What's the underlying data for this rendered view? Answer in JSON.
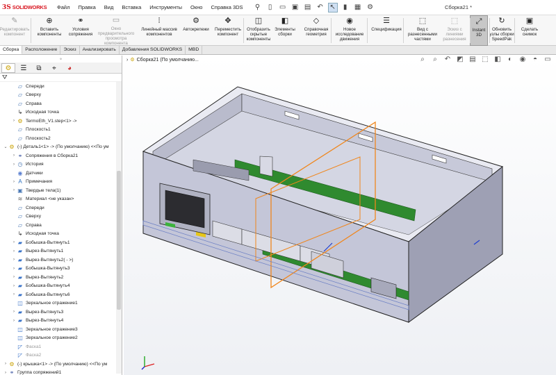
{
  "app": {
    "logo_ds": "3S",
    "logo_name": "SOLIDWORKS",
    "document_title": "Сборка21 *"
  },
  "menu": [
    "Файл",
    "Правка",
    "Вид",
    "Вставка",
    "Инструменты",
    "Окно",
    "Справка 3DS"
  ],
  "ribbon": [
    {
      "label": "Редактировать компонент",
      "icon": "edit-component-icon",
      "glyph": "✎",
      "disabled": true
    },
    {
      "label": "Вставить компоненты",
      "icon": "insert-components-icon",
      "glyph": "⊕",
      "disabled": false
    },
    {
      "label": "Условия сопряжения",
      "icon": "mate-icon",
      "glyph": "⚭",
      "disabled": false
    },
    {
      "label": "Окно предварительного просмотра компонента",
      "icon": "component-preview-icon",
      "glyph": "▭",
      "disabled": true
    },
    {
      "label": "Линейный массив компонентов",
      "icon": "linear-pattern-icon",
      "glyph": "⁞",
      "disabled": false
    },
    {
      "label": "Автокрепежи",
      "icon": "smart-fasteners-icon",
      "glyph": "⚙",
      "disabled": false
    },
    {
      "label": "Переместить компонент",
      "icon": "move-component-icon",
      "glyph": "✥",
      "disabled": false
    },
    {
      "label": "Отобразить скрытые компоненты",
      "icon": "show-hidden-icon",
      "glyph": "◫",
      "disabled": false
    },
    {
      "label": "Элементы сборки",
      "icon": "assembly-features-icon",
      "glyph": "◧",
      "disabled": false
    },
    {
      "label": "Справочная геометрия",
      "icon": "reference-geometry-icon",
      "glyph": "◇",
      "disabled": false
    },
    {
      "label": "Новое исследование движения",
      "icon": "motion-study-icon",
      "glyph": "◉",
      "disabled": false
    },
    {
      "label": "Спецификация",
      "icon": "bom-icon",
      "glyph": "☰",
      "disabled": false
    },
    {
      "label": "Вид с разнесенными частями",
      "icon": "exploded-view-icon",
      "glyph": "⬚",
      "disabled": false
    },
    {
      "label": "Эскиз с линиями разнесения",
      "icon": "explode-line-sketch-icon",
      "glyph": "⬚",
      "disabled": true
    },
    {
      "label": "Instant 3D",
      "icon": "instant3d-icon",
      "glyph": "⤢",
      "disabled": false,
      "active": true
    },
    {
      "label": "Обновить узлы сборки SpeedPak",
      "icon": "speedpak-icon",
      "glyph": "↻",
      "disabled": false
    },
    {
      "label": "Сделать снимок",
      "icon": "snapshot-icon",
      "glyph": "▣",
      "disabled": false
    }
  ],
  "tabs": [
    {
      "label": "Сборка",
      "active": true
    },
    {
      "label": "Расположение",
      "active": false
    },
    {
      "label": "Эскиз",
      "active": false
    },
    {
      "label": "Анализировать",
      "active": false
    },
    {
      "label": "Добавления SOLIDWORKS",
      "active": false
    },
    {
      "label": "MBD",
      "active": false
    }
  ],
  "tree": [
    {
      "label": "Спереди",
      "level": 2,
      "icon": "plane-icon",
      "glyph": "▱",
      "exp": ""
    },
    {
      "label": "Сверху",
      "level": 2,
      "icon": "plane-icon",
      "glyph": "▱",
      "exp": ""
    },
    {
      "label": "Справа",
      "level": 2,
      "icon": "plane-icon",
      "glyph": "▱",
      "exp": ""
    },
    {
      "label": "Исходная точка",
      "level": 2,
      "icon": "origin-icon",
      "glyph": "↳",
      "exp": ""
    },
    {
      "label": "TermoEth_V1.step<1> ->",
      "level": 2,
      "icon": "assembly-icon",
      "glyph": "⚙",
      "exp": "›"
    },
    {
      "label": "Плоскость1",
      "level": 2,
      "icon": "plane-icon",
      "glyph": "▱",
      "exp": ""
    },
    {
      "label": "Плоскость2",
      "level": 2,
      "icon": "plane-icon",
      "glyph": "▱",
      "exp": ""
    },
    {
      "label": "(-) Деталь1<1> -> (По умолчанию) <<По ум",
      "level": 1,
      "icon": "part-icon",
      "glyph": "⚙",
      "exp": "⌄"
    },
    {
      "label": "Сопряжения в Сборка21",
      "level": 2,
      "icon": "mates-icon",
      "glyph": "⚭",
      "exp": "›"
    },
    {
      "label": "История",
      "level": 2,
      "icon": "history-icon",
      "glyph": "◷",
      "exp": "›"
    },
    {
      "label": "Датчики",
      "level": 2,
      "icon": "sensors-icon",
      "glyph": "◉",
      "exp": ""
    },
    {
      "label": "Примечания",
      "level": 2,
      "icon": "annotations-icon",
      "glyph": "A",
      "exp": "›"
    },
    {
      "label": "Твердые тела(1)",
      "level": 2,
      "icon": "solid-bodies-icon",
      "glyph": "▣",
      "exp": "›"
    },
    {
      "label": "Материал <не указан>",
      "level": 2,
      "icon": "material-icon",
      "glyph": "≋",
      "exp": ""
    },
    {
      "label": "Спереди",
      "level": 2,
      "icon": "plane-icon",
      "glyph": "▱",
      "exp": ""
    },
    {
      "label": "Сверху",
      "level": 2,
      "icon": "plane-icon",
      "glyph": "▱",
      "exp": ""
    },
    {
      "label": "Справа",
      "level": 2,
      "icon": "plane-icon",
      "glyph": "▱",
      "exp": ""
    },
    {
      "label": "Исходная точка",
      "level": 2,
      "icon": "origin-icon",
      "glyph": "↳",
      "exp": ""
    },
    {
      "label": "Бобышка-Вытянуть1",
      "level": 2,
      "icon": "extrude-boss-icon",
      "glyph": "▰",
      "exp": "›"
    },
    {
      "label": "Вырез-Вытянуть1",
      "level": 2,
      "icon": "extrude-cut-icon",
      "glyph": "▰",
      "exp": "›"
    },
    {
      "label": "Вырез-Вытянуть2( - >)",
      "level": 2,
      "icon": "extrude-cut-icon",
      "glyph": "▰",
      "exp": "›"
    },
    {
      "label": "Бобышка-Вытянуть3",
      "level": 2,
      "icon": "extrude-boss-icon",
      "glyph": "▰",
      "exp": "›"
    },
    {
      "label": "Вырез-Вытянуть2",
      "level": 2,
      "icon": "extrude-cut-icon",
      "glyph": "▰",
      "exp": "›"
    },
    {
      "label": "Бобышка-Вытянуть4",
      "level": 2,
      "icon": "extrude-boss-icon",
      "glyph": "▰",
      "exp": "›"
    },
    {
      "label": "Бобышка-Вытянуть6",
      "level": 2,
      "icon": "extrude-boss-icon",
      "glyph": "▰",
      "exp": "›"
    },
    {
      "label": "Зеркальное отражение1",
      "level": 2,
      "icon": "mirror-icon",
      "glyph": "◫",
      "exp": ""
    },
    {
      "label": "Вырез-Вытянуть3",
      "level": 2,
      "icon": "extrude-cut-icon",
      "glyph": "▰",
      "exp": "›"
    },
    {
      "label": "Вырез-Вытянуть4",
      "level": 2,
      "icon": "extrude-cut-icon",
      "glyph": "▰",
      "exp": "›"
    },
    {
      "label": "Зеркальное отражение3",
      "level": 2,
      "icon": "mirror-icon",
      "glyph": "◫",
      "exp": ""
    },
    {
      "label": "Зеркальное отражение2",
      "level": 2,
      "icon": "mirror-icon",
      "glyph": "◫",
      "exp": ""
    },
    {
      "label": "Фаска1",
      "level": 2,
      "icon": "chamfer-icon",
      "glyph": "◸",
      "exp": "",
      "dim": true
    },
    {
      "label": "Фаска2",
      "level": 2,
      "icon": "chamfer-icon",
      "glyph": "◸",
      "exp": "",
      "dim": true
    },
    {
      "label": "(-) крышка<1> -> (По умолчанию) <<По ум",
      "level": 1,
      "icon": "part-icon",
      "glyph": "⚙",
      "exp": "›"
    },
    {
      "label": "Группа сопряжений1",
      "level": 1,
      "icon": "mates-icon",
      "glyph": "⚭",
      "exp": "›"
    }
  ],
  "viewport": {
    "tree_label": "Сборка21 (По умолчанию..."
  },
  "colors": {
    "part": "#c9cbdc",
    "pcb": "#2f8a2f",
    "plane": "#f0861c",
    "accent": "#d8141e"
  }
}
